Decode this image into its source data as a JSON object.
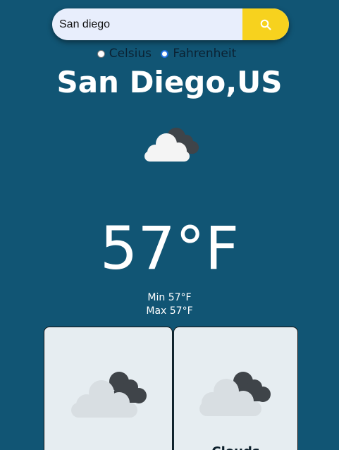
{
  "search": {
    "value": "San diego",
    "icon": "search-icon"
  },
  "units": {
    "celsius_label": "Celsius",
    "fahrenheit_label": "Fahrenheit",
    "selected": "Fahrenheit"
  },
  "current": {
    "city": "San Diego,US",
    "icon": "cloudy-icon",
    "temperature": "57°F",
    "min": "Min 57°F",
    "max": "Max 57°F"
  },
  "forecast": [
    {
      "icon": "cloudy-icon",
      "label": ""
    },
    {
      "icon": "cloudy-icon",
      "label": "Clouds"
    }
  ],
  "colors": {
    "background": "#115574",
    "search_button": "#f7d21e",
    "search_field": "#e8eefc",
    "card_background": "#e6edf1"
  }
}
